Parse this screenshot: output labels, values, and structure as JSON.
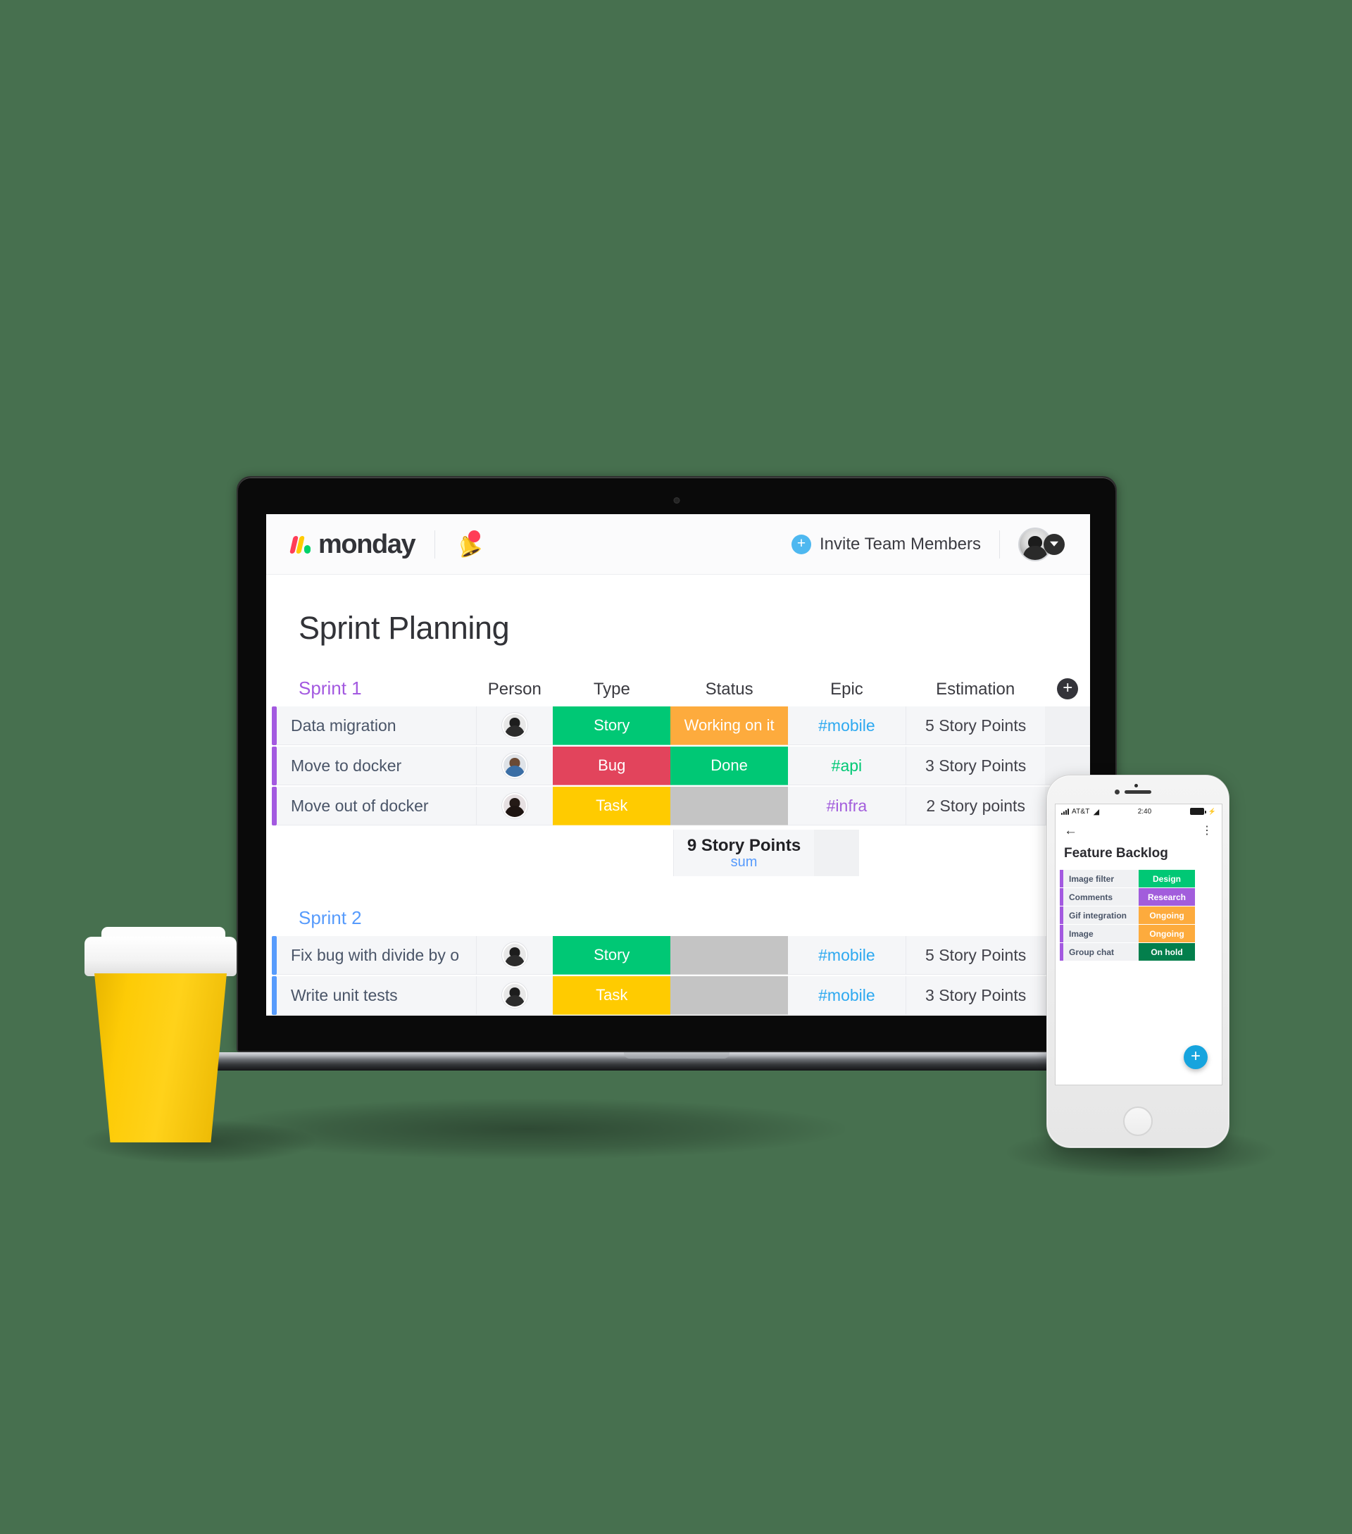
{
  "app": {
    "brand_name": "monday",
    "notification_icon": "bell-icon",
    "invite_label": "Invite Team Members",
    "invite_icon": "plus-circle-icon",
    "avatar_icon": "user-avatar",
    "avatar_caret_icon": "chevron-down-icon"
  },
  "board": {
    "title": "Sprint Planning",
    "add_column_label": "+",
    "columns": {
      "person": "Person",
      "type": "Type",
      "status": "Status",
      "epic": "Epic",
      "estimation": "Estimation"
    },
    "groups": [
      {
        "name": "Sprint 1",
        "color": "#a359e0",
        "rows": [
          {
            "name": "Data migration",
            "person_avatar": "av-suit",
            "type": "Story",
            "type_color": "#00c875",
            "status": "Working on it",
            "status_color": "#fdab3d",
            "epic": "#mobile",
            "epic_color": "#2ea9f0",
            "estimation": "5 Story Points"
          },
          {
            "name": "Move to docker",
            "person_avatar": "av-man",
            "type": "Bug",
            "type_color": "#e2445c",
            "status": "Done",
            "status_color": "#00c875",
            "epic": "#api",
            "epic_color": "#00c875",
            "estimation": "3 Story Points"
          },
          {
            "name": "Move out of docker",
            "person_avatar": "av-woman",
            "type": "Task",
            "type_color": "#ffcb00",
            "status": "",
            "status_color": "#c4c4c4",
            "epic": "#infra",
            "epic_color": "#a25ddc",
            "estimation": "2 Story points"
          }
        ],
        "summary": {
          "value": "9 Story Points",
          "label": "sum"
        }
      },
      {
        "name": "Sprint 2",
        "color": "#579bfc",
        "rows": [
          {
            "name": "Fix bug with divide by o",
            "person_avatar": "av-suit",
            "type": "Story",
            "type_color": "#00c875",
            "status": "",
            "status_color": "#c4c4c4",
            "epic": "#mobile",
            "epic_color": "#2ea9f0",
            "estimation": "5 Story Points"
          },
          {
            "name": "Write unit tests",
            "person_avatar": "av-suit",
            "type": "Task",
            "type_color": "#ffcb00",
            "status": "",
            "status_color": "#c4c4c4",
            "epic": "#mobile",
            "epic_color": "#2ea9f0",
            "estimation": "3 Story Points"
          }
        ]
      }
    ]
  },
  "phone": {
    "status_bar": {
      "carrier": "AT&T",
      "time": "2:40",
      "signal_icon": "signal-bars-icon",
      "wifi_icon": "wifi-icon",
      "battery_icon": "battery-icon",
      "charging_icon": "⚡"
    },
    "back_icon": "←",
    "overflow_icon": "⋮",
    "title": "Feature Backlog",
    "fab_label": "+",
    "rows": [
      {
        "name": "Image filter",
        "status": "Design",
        "status_color": "#00c875"
      },
      {
        "name": "Comments",
        "status": "Research",
        "status_color": "#a25ddc"
      },
      {
        "name": "Gif integration",
        "status": "Ongoing",
        "status_color": "#fdab3d"
      },
      {
        "name": "Image",
        "status": "Ongoing",
        "status_color": "#fdab3d"
      },
      {
        "name": "Group chat",
        "status": "On hold",
        "status_color": "#037f4c"
      }
    ]
  },
  "scene": {
    "background_color": "#47704f",
    "coffee_cup_color": "#fdcb06"
  }
}
